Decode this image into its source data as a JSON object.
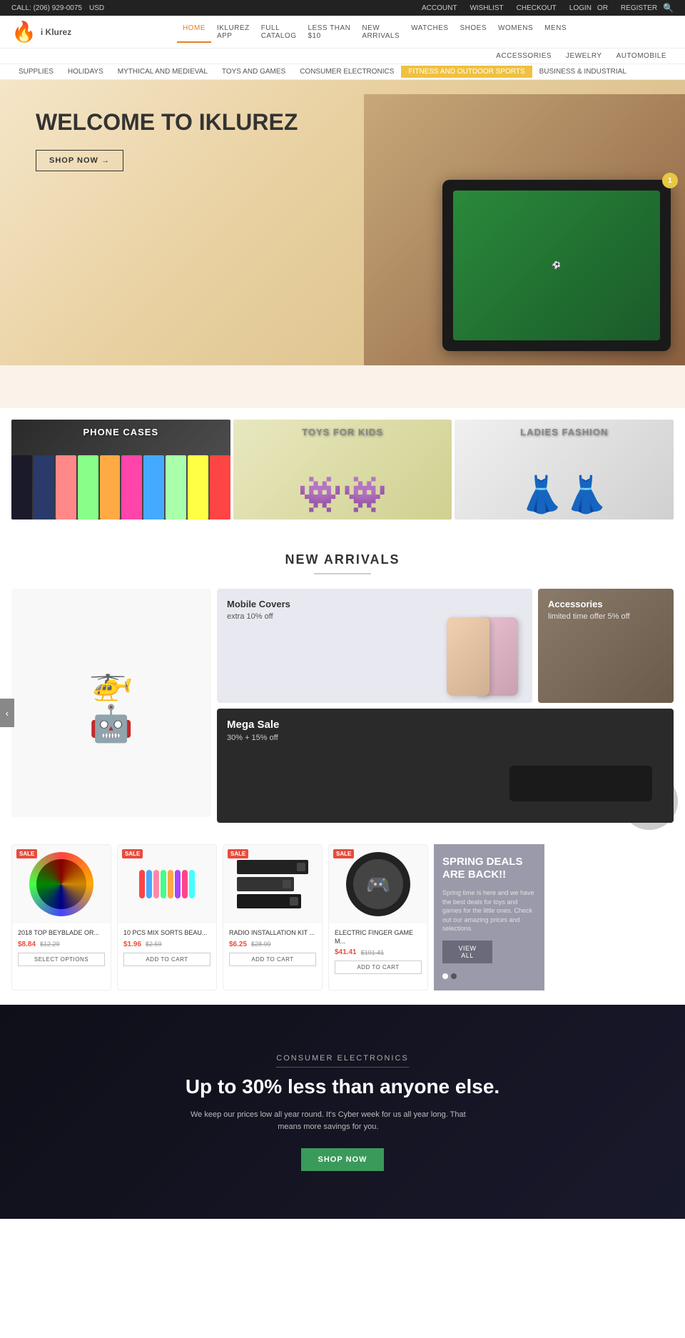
{
  "topbar": {
    "phone": "CALL: (206) 929-0075",
    "currency": "USD",
    "account": "ACCOUNT",
    "wishlist": "WISHLIST",
    "checkout": "CHECKOUT",
    "login": "LOGIN",
    "or": "OR",
    "register": "REGISTER"
  },
  "logo": {
    "text": "i Klurez"
  },
  "mainNav": {
    "items": [
      {
        "label": "HOME",
        "active": true
      },
      {
        "label": "IKLUREZ APP",
        "active": false
      },
      {
        "label": "FULL CATALOG",
        "active": false
      },
      {
        "label": "LESS THAN $10",
        "active": false
      },
      {
        "label": "NEW ARRIVALS",
        "active": false
      },
      {
        "label": "WATCHES",
        "active": false
      },
      {
        "label": "SHOES",
        "active": false
      },
      {
        "label": "WOMENS",
        "active": false
      },
      {
        "label": "MENS",
        "active": false
      }
    ]
  },
  "subNav": {
    "items": [
      {
        "label": "ACCESSORIES"
      },
      {
        "label": "JEWELRY"
      },
      {
        "label": "AUTOMOBILE"
      }
    ]
  },
  "megaNav": {
    "items": [
      {
        "label": "SUPPLIES"
      },
      {
        "label": "HOLIDAYS"
      },
      {
        "label": "MYTHICAL AND MEDIEVAL"
      },
      {
        "label": "TOYS AND GAMES"
      },
      {
        "label": "CONSUMER ELECTRONICS"
      },
      {
        "label": "FITNESS AND OUTDOOR SPORTS",
        "highlight": true
      },
      {
        "label": "BUSINESS & INDUSTRIAL"
      }
    ]
  },
  "hero": {
    "title": "WELCOME TO IKLUREZ",
    "shopBtn": "SHOP NOW →"
  },
  "categoryBanners": [
    {
      "label": "PHONE CASES",
      "type": "dark"
    },
    {
      "label": "TOYS FOR KIDS",
      "type": "light"
    },
    {
      "label": "LADIES FASHION",
      "type": "white"
    }
  ],
  "newArrivals": {
    "sectionTitle": "NEW ARRIVALS",
    "mobileCovers": {
      "title": "Mobile Covers",
      "sub": "extra 10% off"
    },
    "accessories": {
      "title": "Accessories",
      "sub": "limited time offer 5% off"
    },
    "megaSale": {
      "title": "Mega Sale",
      "sub": "30% + 15% off"
    }
  },
  "products": [
    {
      "name": "2018 TOP BEYBLADE OR...",
      "salePrice": "$8.84",
      "oldPrice": "$12.29",
      "sale": true,
      "btnType": "select",
      "btnLabel": "SELECT OPTIONS"
    },
    {
      "name": "10 PCS MIX SORTS BEAU...",
      "salePrice": "$1.96",
      "oldPrice": "$2.59",
      "sale": true,
      "btnType": "cart",
      "btnLabel": "ADD TO CART"
    },
    {
      "name": "RADIO INSTALLATION KIT ...",
      "salePrice": "$6.25",
      "oldPrice": "$28.99",
      "sale": true,
      "btnType": "cart",
      "btnLabel": "ADD TO CART"
    },
    {
      "name": "ELECTRIC FINGER GAME M...",
      "salePrice": "$41.41",
      "oldPrice": "$101.41",
      "sale": true,
      "btnType": "cart",
      "btnLabel": "ADD TO CART"
    }
  ],
  "springDeals": {
    "title": "SPRING DEALS ARE BACK!!",
    "description": "Spring time is here and we have the best deals for toys and games for the little ones. Check out our amazing prices and selections.",
    "viewAllBtn": "VIEW ALL"
  },
  "consumerBanner": {
    "tag": "Consumer Electronics",
    "title": "Up to 30% less than anyone else.",
    "desc": "We keep our prices low all year round. It's Cyber week for us all year long. That means more savings for you.",
    "shopBtn": "SHOP NOW"
  }
}
